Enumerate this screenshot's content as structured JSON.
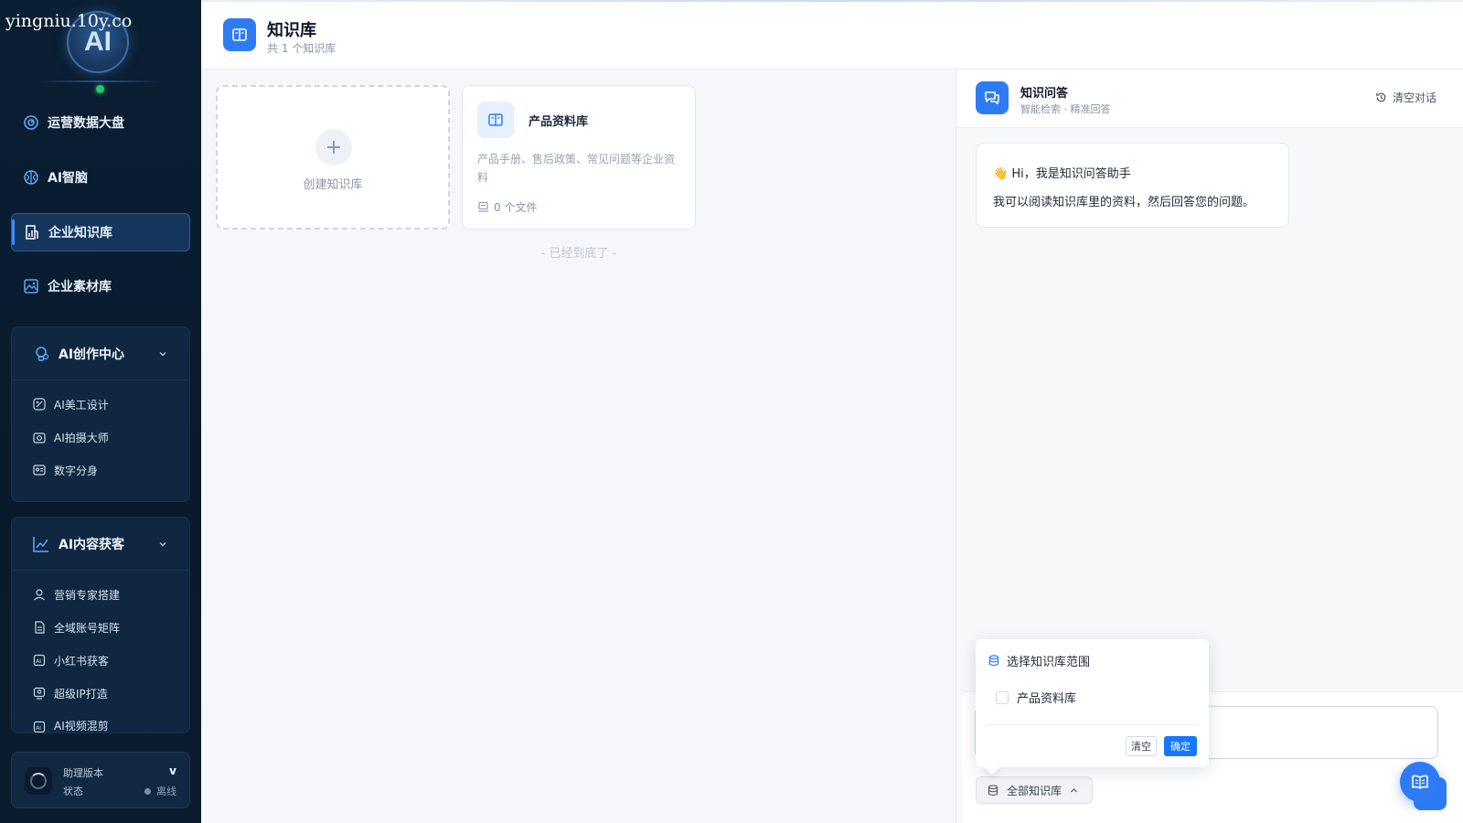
{
  "watermark": "yingniu.10y.co",
  "logo": {
    "text": "AI"
  },
  "sidebar": {
    "items": [
      {
        "label": "运营数据大盘",
        "icon": "dashboard-icon"
      },
      {
        "label": "AI智脑",
        "icon": "brain-icon"
      },
      {
        "label": "企业知识库",
        "icon": "knowledge-icon",
        "active": true
      },
      {
        "label": "企业素材库",
        "icon": "image-icon"
      }
    ],
    "groups": [
      {
        "label": "AI创作中心",
        "icon": "bulb-icon",
        "items": [
          {
            "label": "AI美工设计"
          },
          {
            "label": "AI拍摄大师"
          },
          {
            "label": "数字分身"
          }
        ]
      },
      {
        "label": "AI内容获客",
        "icon": "trend-icon",
        "items": [
          {
            "label": "营销专家搭建"
          },
          {
            "label": "全域账号矩阵"
          },
          {
            "label": "小红书获客"
          },
          {
            "label": "超级IP打造"
          },
          {
            "label": "AI视频混剪"
          }
        ]
      }
    ],
    "footer": {
      "label_version": "助理版本",
      "version_value": "v",
      "label_status": "状态",
      "status_value": "离线"
    }
  },
  "header": {
    "title": "知识库",
    "subtitle": "共 1 个知识库"
  },
  "knowledge": {
    "create_label": "创建知识库",
    "cards": [
      {
        "name": "产品资料库",
        "desc": "产品手册、售后政策、常见问题等企业资料",
        "files": "0 个文件"
      }
    ],
    "end_text": "- 已经到底了 -"
  },
  "chat": {
    "title": "知识问答",
    "subtitle": "智能检索 · 精准回答",
    "clear_label": "清空对话",
    "greeting": "👋 Hi，我是知识问答助手",
    "intro": "我可以阅读知识库里的资料，然后回答您的问题。",
    "scope_button": "全部知识库",
    "popover": {
      "title": "选择知识库范围",
      "option": "产品资料库",
      "clear": "清空",
      "confirm": "确定"
    }
  },
  "colors": {
    "accent": "#2f7bf6",
    "sidebar_bg": "#0b1f33",
    "online": "#27c46b"
  }
}
